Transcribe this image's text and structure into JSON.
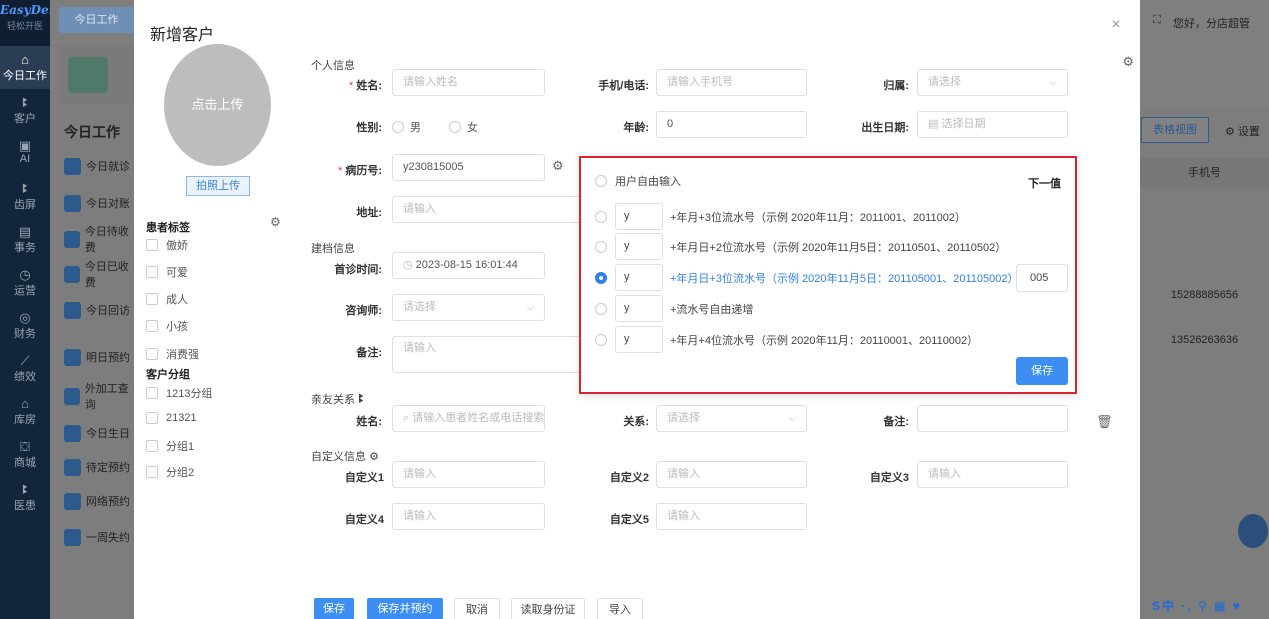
{
  "nav": {
    "logo": "EasyDent",
    "logo_sub": "轻松开医",
    "items": [
      {
        "label": "今日工作",
        "icon": "home-icon",
        "glyph": "⌂"
      },
      {
        "label": "客户",
        "icon": "user-icon",
        "glyph": "ꔪ"
      },
      {
        "label": "AI",
        "icon": "ai-icon",
        "glyph": "▣"
      },
      {
        "label": "齿屏",
        "icon": "tooth-icon",
        "glyph": "ꔪ"
      },
      {
        "label": "事务",
        "icon": "task-icon",
        "glyph": "▤"
      },
      {
        "label": "运营",
        "icon": "operations-icon",
        "glyph": "◷"
      },
      {
        "label": "财务",
        "icon": "finance-icon",
        "glyph": "◎"
      },
      {
        "label": "绩效",
        "icon": "performance-icon",
        "glyph": "⟋"
      },
      {
        "label": "库房",
        "icon": "warehouse-icon",
        "glyph": "⌂"
      },
      {
        "label": "商城",
        "icon": "mall-icon",
        "glyph": "⛋"
      },
      {
        "label": "医患",
        "icon": "doctor-patient-icon",
        "glyph": "ꔪ"
      }
    ]
  },
  "bg": {
    "tab": "今日工作",
    "title": "今日工作",
    "menu": [
      "今日就诊",
      "今日对账",
      "今日待收费",
      "今日已收费",
      "今日回访",
      "明日预约",
      "外加工查询",
      "今日生日",
      "待定预约",
      "网络预约",
      "一周失约"
    ],
    "greeting": "您好，分店超管",
    "table_view": "表格视图",
    "settings": "设置",
    "col_phone": "手机号",
    "phones": [
      "15288885656",
      "13526263636"
    ]
  },
  "modal": {
    "title": "新增客户",
    "upload_text": "点击上传",
    "photo_upload": "拍照上传",
    "patient_tags_title": "患者标签",
    "tags": [
      "傲娇",
      "可爱",
      "成人",
      "小孩",
      "消费强"
    ],
    "customer_group_title": "客户分组",
    "groups": [
      "1213分组",
      "21321",
      "分组1",
      "分组2"
    ],
    "section_personal": "个人信息",
    "name_label": "姓名:",
    "name_placeholder": "请输入姓名",
    "phone_label": "手机/电话:",
    "phone_placeholder": "请输入手机号",
    "belong_label": "归属:",
    "belong_placeholder": "请选择",
    "gender_label": "性别:",
    "gender_male": "男",
    "gender_female": "女",
    "age_label": "年龄:",
    "age_value": "0",
    "birth_label": "出生日期:",
    "birth_placeholder": "选择日期",
    "record_label": "病历号:",
    "record_value": "y230815005",
    "address_label": "地址:",
    "address_placeholder": "请输入",
    "section_file": "建档信息",
    "first_visit_label": "首诊时间:",
    "first_visit_value": "2023-08-15 16:01:44",
    "consultant_label": "咨询师:",
    "consultant_placeholder": "请选择",
    "remark_label": "备注:",
    "remark_placeholder": "请输入",
    "section_relatives": "亲友关系",
    "rel_name_label": "姓名:",
    "rel_name_placeholder": "请输入患者姓名或电话搜索",
    "relation_label": "关系:",
    "relation_placeholder": "请选择",
    "rel_remark_label": "备注:",
    "section_custom": "自定义信息",
    "custom1_label": "自定义1",
    "custom2_label": "自定义2",
    "custom3_label": "自定义3",
    "custom4_label": "自定义4",
    "custom5_label": "自定义5",
    "custom_placeholder": "请输入",
    "buttons": {
      "save": "保存",
      "save_and_book": "保存并预约",
      "cancel": "取消",
      "read_id": "读取身份证",
      "import": "导入"
    }
  },
  "popover": {
    "free_input": "用户自由输入",
    "next_value_label": "下一值",
    "prefix": "y",
    "options": [
      "+年月+3位流水号（示例 2020年11月：2011001、2011002）",
      "+年月日+2位流水号（示例 2020年11月5日：20110501、20110502）",
      "+年月日+3位流水号（示例 2020年11月5日：201105001、201105002）",
      "+流水号自由递增",
      "+年月+4位流水号（示例 2020年11月：20110001、20110002）"
    ],
    "selected_index": 2,
    "next_value": "005",
    "save": "保存"
  },
  "colors": {
    "primary": "#3d8ef3",
    "highlight_border": "#d9262e",
    "required": "#e83c3c",
    "nav_bg": "#13253a"
  }
}
